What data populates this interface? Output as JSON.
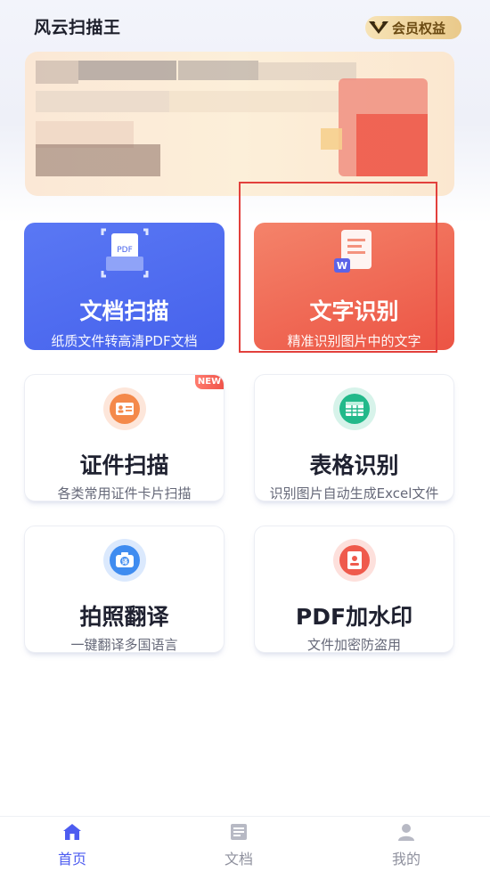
{
  "header": {
    "app_title": "风云扫描王",
    "vip_label": "会员权益"
  },
  "features": [
    {
      "id": "doc-scan",
      "title": "文档扫描",
      "subtitle": "纸质文件转高清PDF文档",
      "icon": "pdf-scan-icon"
    },
    {
      "id": "text-recognition",
      "title": "文字识别",
      "subtitle": "精准识别图片中的文字",
      "icon": "word-document-icon"
    },
    {
      "id": "id-scan",
      "title": "证件扫描",
      "subtitle": "各类常用证件卡片扫描",
      "icon": "id-card-icon",
      "badge": "NEW"
    },
    {
      "id": "table-recognition",
      "title": "表格识别",
      "subtitle": "识别图片自动生成Excel文件",
      "icon": "table-icon"
    },
    {
      "id": "photo-translate",
      "title": "拍照翻译",
      "subtitle": "一键翻译多国语言",
      "icon": "camera-translate-icon"
    },
    {
      "id": "pdf-watermark",
      "title": "PDF加水印",
      "subtitle": "文件加密防盗用",
      "icon": "watermark-icon"
    }
  ],
  "tabbar": {
    "items": [
      {
        "label": "首页",
        "icon": "home-icon",
        "active": true
      },
      {
        "label": "文档",
        "icon": "documents-icon",
        "active": false
      },
      {
        "label": "我的",
        "icon": "profile-icon",
        "active": false
      }
    ]
  },
  "colors": {
    "blue_card": "#4f6cf0",
    "red_card": "#ef5e4b",
    "active_tab": "#4d5cf0",
    "inactive_tab": "#9a9ca8",
    "highlight": "#e2403c"
  }
}
